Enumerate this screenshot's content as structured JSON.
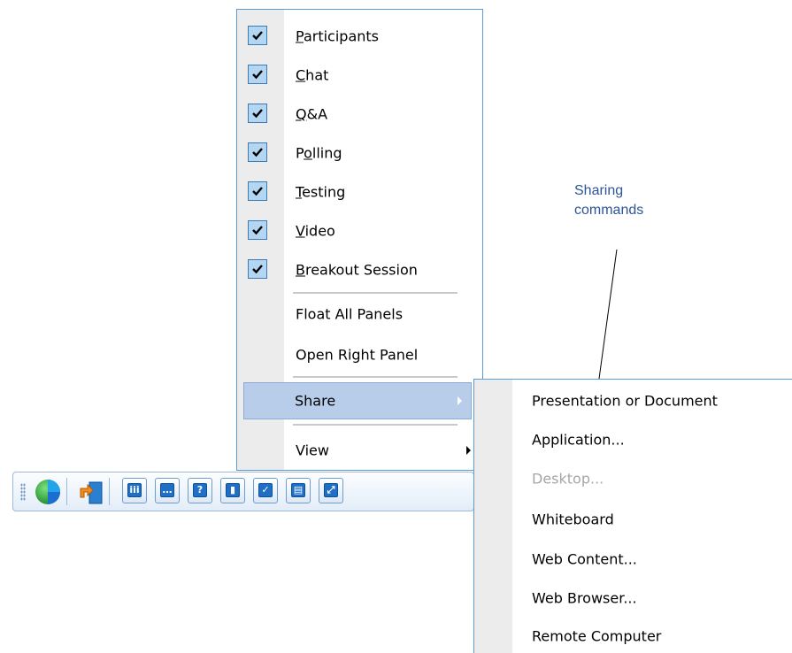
{
  "main_menu": {
    "items": [
      {
        "label_pre": "",
        "label_ul": "P",
        "label_post": "articipants",
        "checked": true
      },
      {
        "label_pre": "",
        "label_ul": "C",
        "label_post": "hat",
        "checked": true
      },
      {
        "label_pre": "",
        "label_ul": "Q",
        "label_post": "&A",
        "checked": true
      },
      {
        "label_pre": "P",
        "label_ul": "o",
        "label_post": "lling",
        "checked": true
      },
      {
        "label_pre": "",
        "label_ul": "T",
        "label_post": "esting",
        "checked": true
      },
      {
        "label_pre": "",
        "label_ul": "V",
        "label_post": "ideo",
        "checked": true
      },
      {
        "label_pre": "",
        "label_ul": "B",
        "label_post": "reakout Session",
        "checked": true
      }
    ],
    "float_all_panels": "Float All Panels",
    "open_right_panel": "Open Right Panel",
    "share": "Share",
    "view": "View"
  },
  "share_menu": {
    "items": [
      {
        "label": "Presentation or Document",
        "enabled": true
      },
      {
        "label": "Application...",
        "enabled": true
      },
      {
        "label": "Desktop...",
        "enabled": false
      },
      {
        "label": "Whiteboard",
        "enabled": true
      },
      {
        "label": "Web Content...",
        "enabled": true
      },
      {
        "label": "Web Browser...",
        "enabled": true
      },
      {
        "label": "Remote Computer",
        "enabled": true
      }
    ]
  },
  "toolbar": {
    "icons": [
      "webex-globe-icon",
      "leave-session-icon",
      "participants-icon",
      "chat-icon",
      "qa-icon",
      "polling-icon",
      "testing-icon",
      "video-icon",
      "breakout-icon"
    ],
    "glyphs": [
      "",
      "",
      "iii",
      "…",
      "?",
      "▮",
      "✓",
      "▤",
      "⤢"
    ]
  },
  "callout": {
    "line1": "Sharing",
    "line2": "commands"
  },
  "colors": {
    "menu_border": "#5a9bd6",
    "check_bg": "#b3d7f3",
    "highlight": "#b7cdea",
    "callout_text": "#2f5597"
  }
}
